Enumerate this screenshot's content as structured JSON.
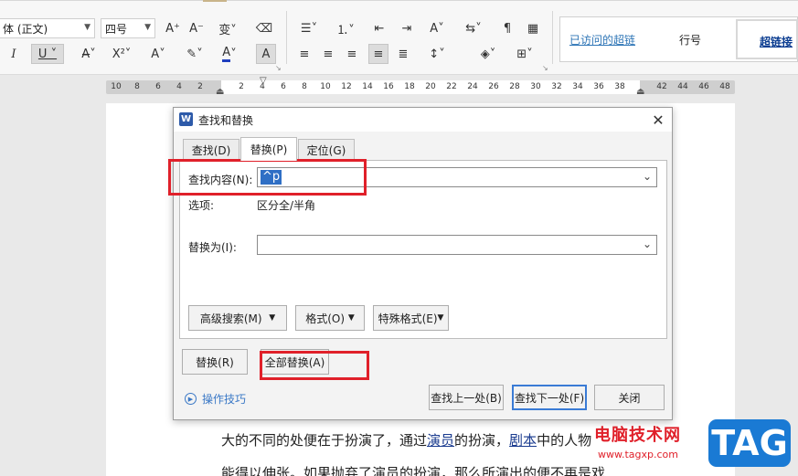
{
  "ribbon": {
    "font_name": "体 (正文)",
    "font_size": "四号",
    "styles": {
      "visited_link": "已访问的超链",
      "row_number": "行号",
      "hyperlink": "超链接"
    }
  },
  "ruler": {
    "ticks": [
      "10",
      "8",
      "6",
      "4",
      "2",
      "2",
      "4",
      "6",
      "8",
      "10",
      "12",
      "14",
      "16",
      "18",
      "20",
      "22",
      "24",
      "26",
      "28",
      "30",
      "32",
      "34",
      "36",
      "38",
      "42",
      "44",
      "46",
      "48"
    ]
  },
  "document": {
    "line1_a": "大的不同的处便在于扮演了，通过",
    "line1_link1": "演员",
    "line1_b": "的扮演，",
    "line1_link2": "剧本",
    "line1_c": "中的人物",
    "line2": "能得以伸张。如果抛弃了演员的扮演，那么所演出的便不再是戏"
  },
  "watermark": {
    "site_name": "电脑技术网",
    "url": "www.tagxp.com",
    "tag": "TAG"
  },
  "dialog": {
    "app_icon": "W",
    "title": "查找和替换",
    "tabs": [
      "查找(D)",
      "替换(P)",
      "定位(G)"
    ],
    "find_label": "查找内容(N):",
    "find_value": "^p",
    "options_label": "选项:",
    "options_value": "区分全/半角",
    "replace_label": "替换为(I):",
    "replace_value": "",
    "btn_advanced": "高级搜索(M)",
    "btn_format": "格式(O)",
    "btn_special": "特殊格式(E)",
    "btn_replace": "替换(R)",
    "btn_replace_all": "全部替换(A)",
    "tips": "操作技巧",
    "btn_find_prev": "查找上一处(B)",
    "btn_find_next": "查找下一处(F)",
    "btn_close": "关闭"
  },
  "colors": {
    "highlight_box": "#e0202a",
    "selection": "#2f6fc5",
    "link": "#1a3b8f",
    "tag_blue": "#1a7ad4"
  }
}
